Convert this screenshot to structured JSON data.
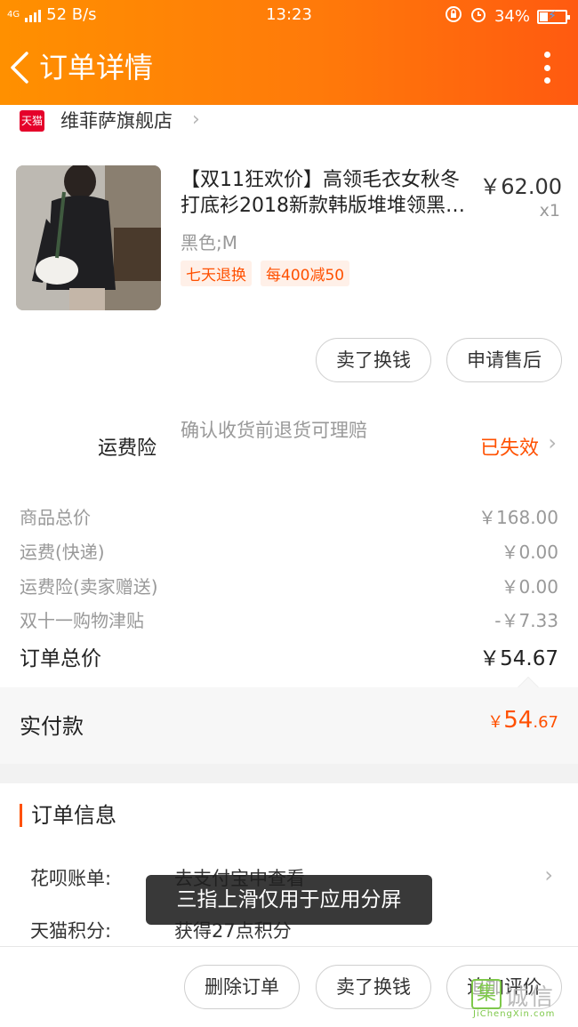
{
  "status_bar": {
    "network": "4G",
    "speed": "52 B/s",
    "time": "13:23",
    "battery": "34%"
  },
  "header": {
    "title": "订单详情"
  },
  "shop": {
    "logo_text": "天猫",
    "name": "维菲萨旗舰店"
  },
  "product": {
    "title": "【双11狂欢价】高领毛衣女秋冬打底衫2018新款韩版堆堆领黑…",
    "price": "￥62.00",
    "qty": "x1",
    "sku": "黑色;M",
    "tags": [
      "七天退换",
      "每400减50"
    ]
  },
  "item_actions": {
    "sell": "卖了换钱",
    "after_sale": "申请售后"
  },
  "insurance": {
    "label": "运费险",
    "desc": "确认收货前退货可理赔",
    "status": "已失效"
  },
  "summary": [
    {
      "label": "商品总价",
      "value": "￥168.00"
    },
    {
      "label": "运费(快递)",
      "value": "￥0.00"
    },
    {
      "label": "运费险(卖家赠送)",
      "value": "￥0.00"
    },
    {
      "label": "双十一购物津贴",
      "value": "-￥7.33"
    }
  ],
  "total": {
    "label": "订单总价",
    "value": "￥54.67"
  },
  "paid": {
    "label": "实付款",
    "yen": "￥",
    "int": "54",
    "dec": ".67"
  },
  "order_info": {
    "title": "订单信息",
    "rows": [
      {
        "key": "花呗账单:",
        "value": "去支付宝中查看"
      },
      {
        "key": "天猫积分:",
        "value": "获得27点积分"
      }
    ]
  },
  "toast": "三指上滑仅用于应用分屏",
  "bottom_actions": {
    "delete": "删除订单",
    "sell": "卖了换钱",
    "review": "追加评价"
  },
  "watermark": {
    "cn": "诚信",
    "en": "JiChengXin.com",
    "box": "集"
  }
}
